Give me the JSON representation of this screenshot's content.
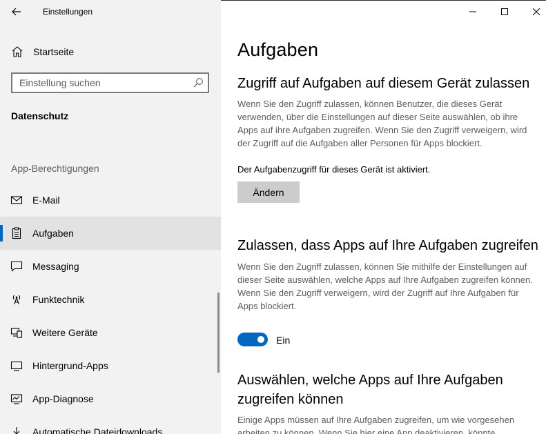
{
  "window": {
    "app_title": "Einstellungen"
  },
  "sidebar": {
    "home_label": "Startseite",
    "search_placeholder": "Einstellung suchen",
    "section_title": "Datenschutz",
    "group_title": "App-Berechtigungen",
    "items": [
      {
        "label": "E-Mail",
        "icon": "mail-icon",
        "selected": false
      },
      {
        "label": "Aufgaben",
        "icon": "clipboard-icon",
        "selected": true
      },
      {
        "label": "Messaging",
        "icon": "chat-icon",
        "selected": false
      },
      {
        "label": "Funktechnik",
        "icon": "antenna-icon",
        "selected": false
      },
      {
        "label": "Weitere Geräte",
        "icon": "devices-icon",
        "selected": false
      },
      {
        "label": "Hintergrund-Apps",
        "icon": "background-apps-icon",
        "selected": false
      },
      {
        "label": "App-Diagnose",
        "icon": "diagnostics-icon",
        "selected": false
      },
      {
        "label": "Automatische Dateidownloads",
        "icon": "download-icon",
        "selected": false
      }
    ]
  },
  "main": {
    "page_title": "Aufgaben",
    "section1": {
      "heading": "Zugriff auf Aufgaben auf diesem Gerät zulassen",
      "description": "Wenn Sie den Zugriff zulassen, können Benutzer, die dieses Gerät verwenden, über die Einstellungen auf dieser Seite auswählen, ob ihre Apps auf ihre Aufgaben zugreifen. Wenn Sie den Zugriff verweigern, wird der Zugriff auf die Aufgaben aller Personen für Apps blockiert.",
      "status": "Der Aufgabenzugriff für dieses Gerät ist aktiviert.",
      "button_label": "Ändern"
    },
    "section2": {
      "heading": "Zulassen, dass Apps auf Ihre Aufgaben zugreifen",
      "description": "Wenn Sie den Zugriff zulassen, können Sie mithilfe der Einstellungen auf dieser Seite auswählen, welche Apps auf Ihre Aufgaben zugreifen können. Wenn Sie den Zugriff verweigern, wird der Zugriff auf Ihre Aufgaben für Apps blockiert.",
      "toggle_on": true,
      "toggle_label": "Ein"
    },
    "section3": {
      "heading": "Auswählen, welche Apps auf Ihre Aufgaben zugreifen können",
      "description": "Einige Apps müssen auf Ihre Aufgaben zugreifen, um wie vorgesehen arbeiten zu können. Wenn Sie hier eine App deaktivieren, könnte"
    }
  },
  "colors": {
    "accent": "#0067c0",
    "sidebar_bg": "#f2f2f2",
    "selected_bg": "#e2e2e2",
    "button_bg": "#cccccc",
    "secondary_text": "#5d5d5d"
  }
}
